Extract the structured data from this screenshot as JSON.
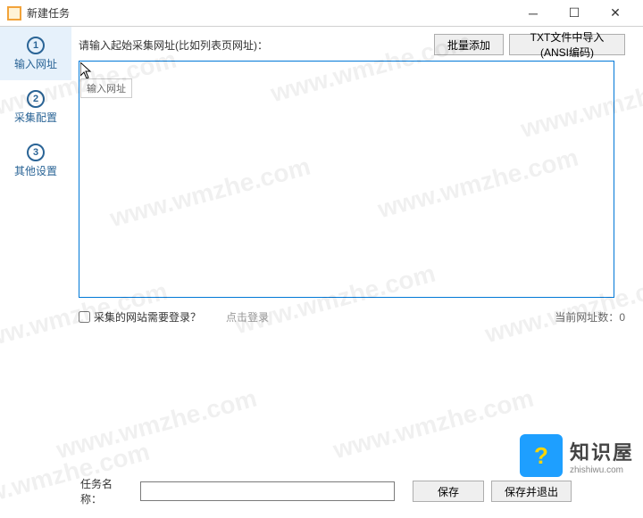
{
  "window": {
    "title": "新建任务"
  },
  "sidebar": {
    "items": [
      {
        "num": "①",
        "label": "输入网址"
      },
      {
        "num": "②",
        "label": "采集配置"
      },
      {
        "num": "③",
        "label": "其他设置"
      }
    ]
  },
  "top": {
    "prompt": "请输入起始采集网址(比如列表页网址)：",
    "batch_add": "批量添加",
    "txt_import": "TXT文件中导入(ANSI编码)"
  },
  "textarea": {
    "value": "",
    "tooltip": "输入网址"
  },
  "below": {
    "login_q": "采集的网站需要登录？",
    "login_link": "点击登录",
    "count_label": "当前网址数：",
    "count": "0"
  },
  "bottom": {
    "task_name_label": "任务名称：",
    "task_name_value": "",
    "save": "保存",
    "save_exit": "保存并退出"
  },
  "watermark": "www.wmzhe.com",
  "brand": {
    "cn": "知识屋",
    "en": "zhishiwu.com",
    "icon": "?"
  }
}
